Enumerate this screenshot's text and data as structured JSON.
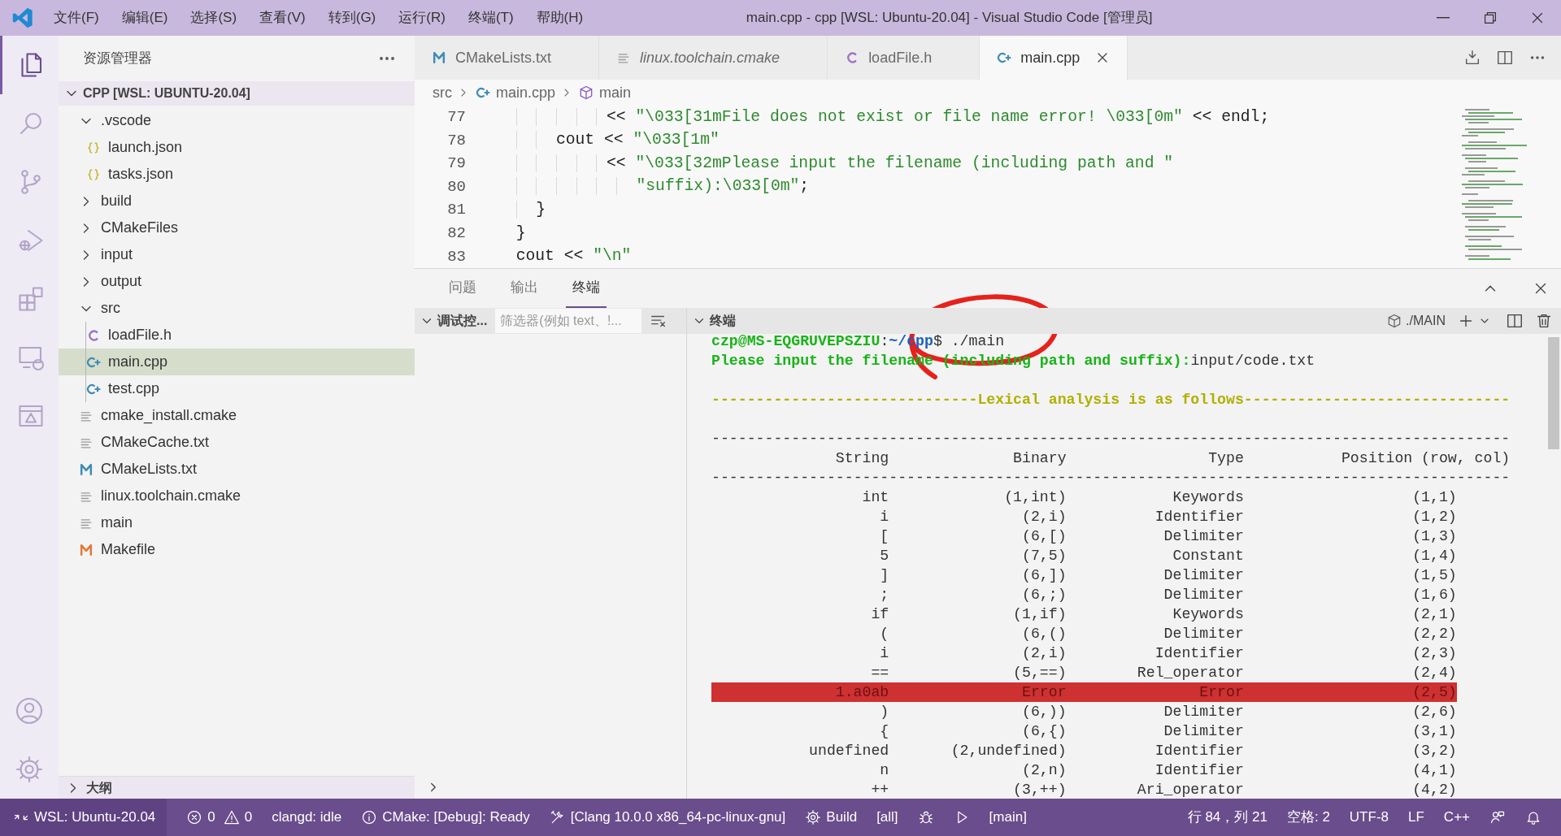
{
  "title_bar": {
    "menus": [
      "文件(F)",
      "编辑(E)",
      "选择(S)",
      "查看(V)",
      "转到(G)",
      "运行(R)",
      "终端(T)",
      "帮助(H)"
    ],
    "title": "main.cpp - cpp [WSL: Ubuntu-20.04] - Visual Studio Code [管理员]"
  },
  "activity_bar": {
    "items": [
      {
        "kind": "files",
        "selected": true
      },
      {
        "kind": "search",
        "selected": false
      },
      {
        "kind": "scm",
        "selected": false
      },
      {
        "kind": "debug",
        "selected": false
      },
      {
        "kind": "extensions",
        "selected": false
      },
      {
        "kind": "remote",
        "selected": false
      },
      {
        "kind": "cmake",
        "selected": false
      }
    ],
    "bottom_items": [
      {
        "kind": "account"
      },
      {
        "kind": "gear"
      }
    ]
  },
  "sidebar": {
    "title": "资源管理器",
    "root": {
      "label": "CPP [WSL: UBUNTU-20.04]",
      "expanded": true
    },
    "tree": [
      {
        "label": ".vscode",
        "kind": "folder",
        "expanded": true,
        "selected": false,
        "children": [
          {
            "label": "launch.json",
            "kind": "json",
            "selected": false
          },
          {
            "label": "tasks.json",
            "kind": "json",
            "selected": false
          }
        ]
      },
      {
        "label": "build",
        "kind": "folder",
        "expanded": false,
        "selected": false
      },
      {
        "label": "CMakeFiles",
        "kind": "folder",
        "expanded": false,
        "selected": false
      },
      {
        "label": "input",
        "kind": "folder",
        "expanded": false,
        "selected": false
      },
      {
        "label": "output",
        "kind": "folder",
        "expanded": false,
        "selected": false
      },
      {
        "label": "src",
        "kind": "folder",
        "expanded": true,
        "selected": false,
        "children": [
          {
            "label": "loadFile.h",
            "kind": "c-header",
            "selected": false
          },
          {
            "label": "main.cpp",
            "kind": "cpp",
            "selected": true
          },
          {
            "label": "test.cpp",
            "kind": "cpp",
            "selected": false
          }
        ]
      },
      {
        "label": "cmake_install.cmake",
        "kind": "text",
        "selected": false
      },
      {
        "label": "CMakeCache.txt",
        "kind": "text",
        "selected": false
      },
      {
        "label": "CMakeLists.txt",
        "kind": "cmake-list",
        "selected": false
      },
      {
        "label": "linux.toolchain.cmake",
        "kind": "text",
        "selected": false
      },
      {
        "label": "main",
        "kind": "text",
        "selected": false
      },
      {
        "label": "Makefile",
        "kind": "makefile",
        "selected": false
      }
    ],
    "outline": {
      "label": "大纲",
      "expanded": false
    }
  },
  "tabs": [
    {
      "label": "CMakeLists.txt",
      "kind": "cmake-list",
      "preview": false,
      "selected": false
    },
    {
      "label": "linux.toolchain.cmake",
      "kind": "text",
      "preview": true,
      "selected": false
    },
    {
      "label": "loadFile.h",
      "kind": "c-header",
      "preview": false,
      "selected": false
    },
    {
      "label": "main.cpp",
      "kind": "cpp",
      "preview": false,
      "selected": true
    }
  ],
  "breadcrumb": [
    {
      "label": "src",
      "kind": "folder"
    },
    {
      "label": "main.cpp",
      "kind": "cpp"
    },
    {
      "label": "main",
      "kind": "symbol"
    }
  ],
  "editor": {
    "lines": [
      {
        "number": "77",
        "segments": [
          {
            "text": "           << ",
            "kind": "plain"
          },
          {
            "text": "\"\\033[31mFile does not exist or file name error! \\033[0m\"",
            "kind": "string"
          },
          {
            "text": " << endl;",
            "kind": "plain"
          }
        ]
      },
      {
        "number": "78",
        "segments": [
          {
            "text": "      cout << ",
            "kind": "plain"
          },
          {
            "text": "\"\\033[1m\"",
            "kind": "string"
          }
        ]
      },
      {
        "number": "79",
        "segments": [
          {
            "text": "           << ",
            "kind": "plain"
          },
          {
            "text": "\"\\033[32mPlease input the filename (including path and \"",
            "kind": "string"
          }
        ]
      },
      {
        "number": "80",
        "segments": [
          {
            "text": "              \"suffix):\\033[0m\"",
            "kind": "string"
          },
          {
            "text": ";",
            "kind": "plain"
          }
        ]
      },
      {
        "number": "81",
        "segments": [
          {
            "text": "    }",
            "kind": "plain"
          }
        ]
      },
      {
        "number": "82",
        "segments": [
          {
            "text": "  }",
            "kind": "plain"
          }
        ]
      },
      {
        "number": "83",
        "segments": [
          {
            "text": "  cout << ",
            "kind": "plain"
          },
          {
            "text": "\"\\n\"",
            "kind": "string"
          }
        ]
      }
    ]
  },
  "panel": {
    "tabs": [
      {
        "label": "问题",
        "selected": false
      },
      {
        "label": "输出",
        "selected": false
      },
      {
        "label": "终端",
        "selected": true
      }
    ],
    "debug_console": {
      "title": "调试控...",
      "filter_placeholder": "筛选器(例如 text、!..."
    },
    "terminal": {
      "title": "终端",
      "profile": "./MAIN",
      "lines": [
        {
          "kind": "text",
          "segments": [
            {
              "text": "czp@MS-EQGRUVEPSZIU",
              "kind": "user"
            },
            {
              "text": ":",
              "kind": "plain"
            },
            {
              "text": "~/cpp",
              "kind": "path"
            },
            {
              "text": "$ ./main",
              "kind": "plain"
            }
          ]
        },
        {
          "kind": "text",
          "segments": [
            {
              "text": "Please input the filename (including path and suffix):",
              "kind": "message"
            },
            {
              "text": "input/code.txt",
              "kind": "plain"
            }
          ]
        },
        {
          "kind": "blank"
        },
        {
          "kind": "text",
          "segments": [
            {
              "text": "------------------------------Lexical analysis is as follows------------------------------",
              "kind": "heading"
            }
          ]
        },
        {
          "kind": "blank"
        },
        {
          "kind": "rule",
          "text": "------------------------------------------------------------------------------------------"
        },
        {
          "kind": "header",
          "cells": [
            "String",
            "Binary",
            "Type",
            "Position (row, col)"
          ]
        },
        {
          "kind": "rule",
          "text": "------------------------------------------------------------------------------------------"
        },
        {
          "kind": "row",
          "highlighted": false,
          "cells": [
            "int",
            "(1,int)",
            "Keywords",
            "(1,1)"
          ]
        },
        {
          "kind": "row",
          "highlighted": false,
          "cells": [
            "i",
            "(2,i)",
            "Identifier",
            "(1,2)"
          ]
        },
        {
          "kind": "row",
          "highlighted": false,
          "cells": [
            "[",
            "(6,[)",
            "Delimiter",
            "(1,3)"
          ]
        },
        {
          "kind": "row",
          "highlighted": false,
          "cells": [
            "5",
            "(7,5)",
            "Constant",
            "(1,4)"
          ]
        },
        {
          "kind": "row",
          "highlighted": false,
          "cells": [
            "]",
            "(6,])",
            "Delimiter",
            "(1,5)"
          ]
        },
        {
          "kind": "row",
          "highlighted": false,
          "cells": [
            ";",
            "(6,;)",
            "Delimiter",
            "(1,6)"
          ]
        },
        {
          "kind": "row",
          "highlighted": false,
          "cells": [
            "if",
            "(1,if)",
            "Keywords",
            "(2,1)"
          ]
        },
        {
          "kind": "row",
          "highlighted": false,
          "cells": [
            "(",
            "(6,()",
            "Delimiter",
            "(2,2)"
          ]
        },
        {
          "kind": "row",
          "highlighted": false,
          "cells": [
            "i",
            "(2,i)",
            "Identifier",
            "(2,3)"
          ]
        },
        {
          "kind": "row",
          "highlighted": false,
          "cells": [
            "==",
            "(5,==)",
            "Rel_operator",
            "(2,4)"
          ]
        },
        {
          "kind": "row",
          "highlighted": true,
          "cells": [
            "1.a0ab",
            "Error",
            "Error",
            "(2,5)"
          ]
        },
        {
          "kind": "row",
          "highlighted": false,
          "cells": [
            ")",
            "(6,))",
            "Delimiter",
            "(2,6)"
          ]
        },
        {
          "kind": "row",
          "highlighted": false,
          "cells": [
            "{",
            "(6,{)",
            "Delimiter",
            "(3,1)"
          ]
        },
        {
          "kind": "row",
          "highlighted": false,
          "cells": [
            "undefined",
            "(2,undefined)",
            "Identifier",
            "(3,2)"
          ]
        },
        {
          "kind": "row",
          "highlighted": false,
          "cells": [
            "n",
            "(2,n)",
            "Identifier",
            "(4,1)"
          ]
        },
        {
          "kind": "row",
          "highlighted": false,
          "cells": [
            "++",
            "(3,++)",
            "Ari_operator",
            "(4,2)"
          ]
        }
      ]
    }
  },
  "status_bar": {
    "left": [
      {
        "kind": "remote",
        "label": "WSL: Ubuntu-20.04"
      },
      {
        "kind": "problems",
        "errors": "0",
        "warnings": "0"
      },
      {
        "kind": "text",
        "label": "clangd: idle"
      },
      {
        "kind": "info",
        "label": "CMake: [Debug]: Ready"
      },
      {
        "kind": "tools",
        "label": "[Clang 10.0.0 x86_64-pc-linux-gnu]"
      },
      {
        "kind": "gear",
        "label": "Build"
      },
      {
        "kind": "text",
        "label": "[all]"
      },
      {
        "kind": "bug"
      },
      {
        "kind": "play"
      },
      {
        "kind": "text",
        "label": "[main]"
      }
    ],
    "right": [
      {
        "kind": "text",
        "label": "行 84，列 21"
      },
      {
        "kind": "text",
        "label": "空格: 2"
      },
      {
        "kind": "text",
        "label": "UTF-8"
      },
      {
        "kind": "text",
        "label": "LF"
      },
      {
        "kind": "text",
        "label": "C++"
      },
      {
        "kind": "feedback"
      },
      {
        "kind": "bell"
      }
    ]
  }
}
